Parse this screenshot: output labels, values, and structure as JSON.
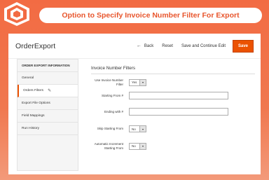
{
  "banner": {
    "title": "Option to Specify Invoice Number Filter For Export"
  },
  "header": {
    "title": "OrderExport",
    "back_label": "Back",
    "reset_label": "Reset",
    "save_continue_label": "Save and Continue Edit",
    "save_label": "Save"
  },
  "sidebar": {
    "heading": "ORDER EXPORT INFORMATION",
    "items": [
      {
        "label": "General"
      },
      {
        "label": "Orders Filters"
      },
      {
        "label": "Export File Options"
      },
      {
        "label": "Field Mappings"
      },
      {
        "label": "Run History"
      }
    ]
  },
  "form": {
    "section_title": "Invoice Number Filters",
    "use_invoice_label": "Use Invoice Number Filter",
    "use_invoice_value": "Yes",
    "starting_from_label": "Starting From #",
    "ending_with_label": "Ending with #",
    "skip_starting_label": "Skip Starting From",
    "skip_starting_value": "No",
    "auto_increment_label": "Automatic Increment Starting From",
    "auto_increment_value": "No"
  },
  "colors": {
    "accent": "#eb5202",
    "background": "#f26b43"
  }
}
